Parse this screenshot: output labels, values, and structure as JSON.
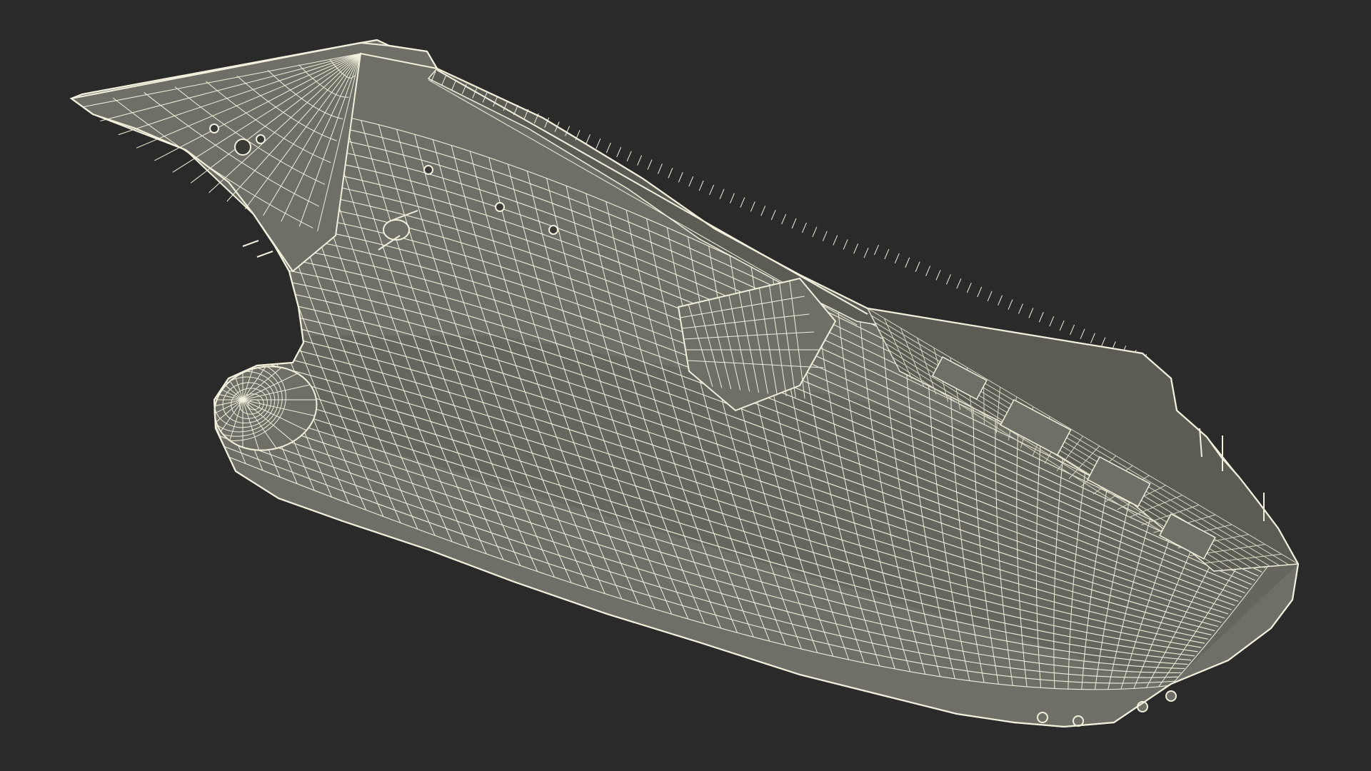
{
  "scene": {
    "background_color": "#2a2a2a",
    "hull_fill_color": "#6f6f67",
    "hull_shade_color": "#5c5c55",
    "wire_color": "#f2f0dc",
    "wire_dim_color": "#d8d6c2",
    "dark_detail_color": "#3a3a36"
  },
  "objects": [
    {
      "name": "aircraft-carrier-hull",
      "view": "wireframe"
    }
  ]
}
